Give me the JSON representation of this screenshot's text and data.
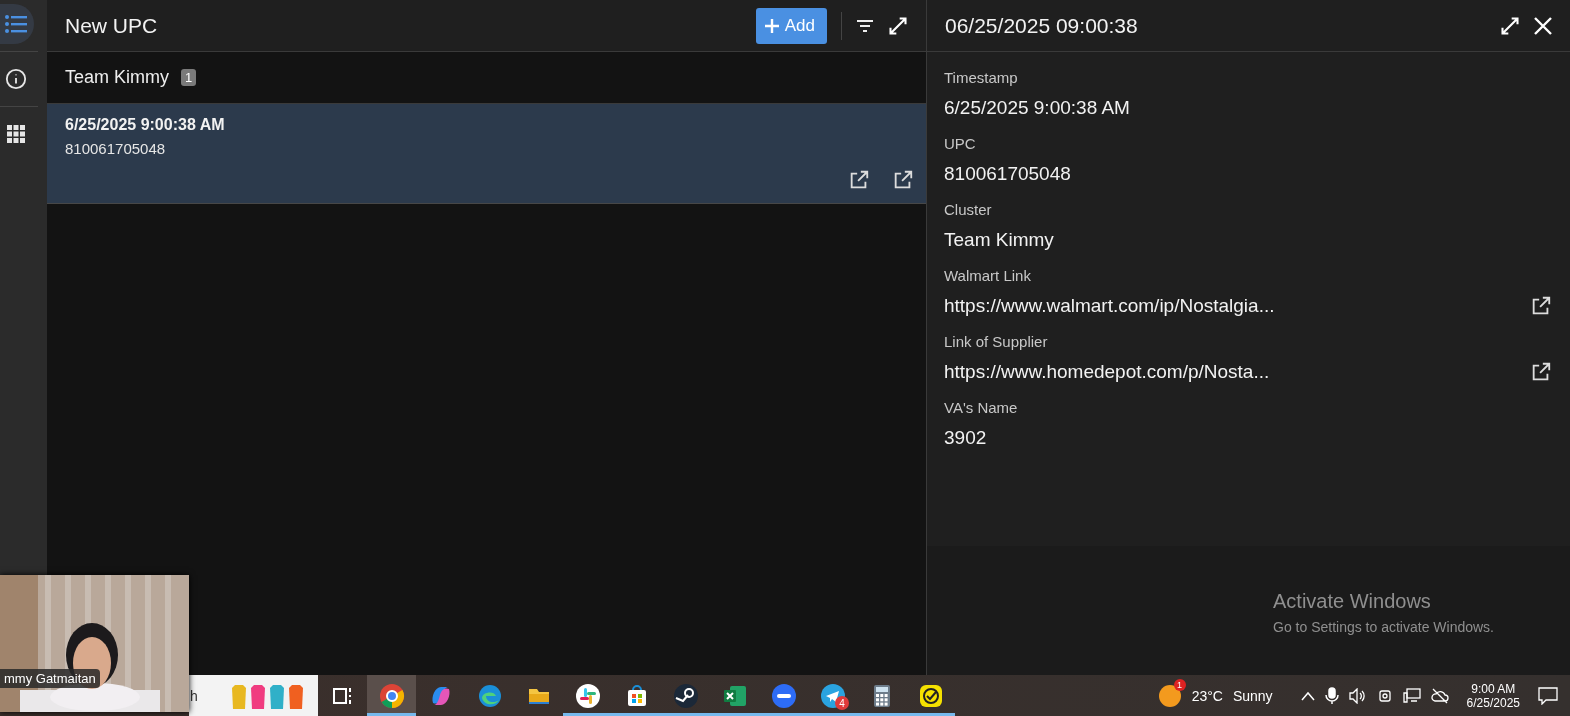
{
  "rail": {
    "items": [
      {
        "kind": "list",
        "selected": true
      },
      {
        "kind": "info",
        "selected": false
      },
      {
        "kind": "apps",
        "selected": false
      }
    ]
  },
  "list_panel": {
    "title": "New UPC",
    "add_button": {
      "label": "Add"
    },
    "groups": [
      {
        "name": "Team Kimmy",
        "count": "1",
        "items": [
          {
            "timestamp": "6/25/2025 9:00:38 AM",
            "upc": "810061705048",
            "selected": true
          }
        ]
      }
    ]
  },
  "detail": {
    "title": "06/25/2025 09:00:38",
    "fields": [
      {
        "label": "Timestamp",
        "value": "6/25/2025 9:00:38 AM",
        "kind": "text"
      },
      {
        "label": "UPC",
        "value": "810061705048",
        "kind": "text"
      },
      {
        "label": "Cluster",
        "value": "Team Kimmy",
        "kind": "text"
      },
      {
        "label": "Walmart Link",
        "value": "https://www.walmart.com/ip/Nostalgia...",
        "kind": "link"
      },
      {
        "label": "Link of Supplier",
        "value": "https://www.homedepot.com/p/Nosta...",
        "kind": "link"
      },
      {
        "label": "VA's Name",
        "value": "3902",
        "kind": "text"
      }
    ]
  },
  "activation_notice": {
    "title": "Activate Windows",
    "subtitle": "Go to Settings to activate Windows."
  },
  "video_call": {
    "name": "mmy Gatmaitan"
  },
  "taskbar": {
    "search": {
      "value": "h"
    },
    "apps": [
      {
        "kind": "taskview",
        "running": false,
        "selected": false
      },
      {
        "kind": "chrome",
        "running": true,
        "selected": true
      },
      {
        "kind": "copilot",
        "running": false,
        "selected": false
      },
      {
        "kind": "edge",
        "running": false,
        "selected": false
      },
      {
        "kind": "folder",
        "running": false,
        "selected": false
      },
      {
        "kind": "slack",
        "running": true,
        "selected": false
      },
      {
        "kind": "store",
        "running": true,
        "selected": false
      },
      {
        "kind": "steam",
        "running": true,
        "selected": false
      },
      {
        "kind": "excel",
        "running": true,
        "selected": false
      },
      {
        "kind": "zoom",
        "running": true,
        "selected": false
      },
      {
        "kind": "telegram",
        "running": true,
        "selected": false,
        "badge": "4"
      },
      {
        "kind": "calculator",
        "running": true,
        "selected": false
      },
      {
        "kind": "check",
        "running": true,
        "selected": false
      }
    ],
    "weather": {
      "badge": "1",
      "temperature": "23°C",
      "condition": "Sunny"
    },
    "clock": {
      "time": "9:00 AM",
      "date": "6/25/2025"
    }
  }
}
